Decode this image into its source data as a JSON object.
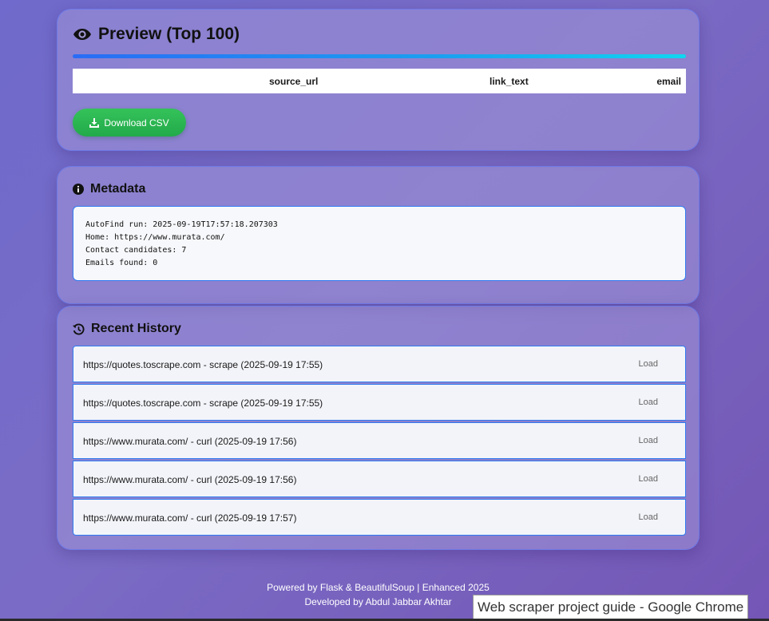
{
  "preview": {
    "title": "Preview (Top 100)",
    "columns": [
      "source_url",
      "link_text",
      "email"
    ],
    "download_label": "Download CSV"
  },
  "metadata": {
    "title": "Metadata",
    "lines": [
      "AutoFind run: 2025-09-19T17:57:18.207303",
      "Home: https://www.murata.com/",
      "Contact candidates: 7",
      "Emails found: 0"
    ]
  },
  "history": {
    "title": "Recent History",
    "items": [
      {
        "text": "https://quotes.toscrape.com - scrape (2025-09-19 17:55)",
        "action": "Load"
      },
      {
        "text": "https://quotes.toscrape.com - scrape (2025-09-19 17:55)",
        "action": "Load"
      },
      {
        "text": "https://www.murata.com/ - curl (2025-09-19 17:56)",
        "action": "Load"
      },
      {
        "text": "https://www.murata.com/ - curl (2025-09-19 17:56)",
        "action": "Load"
      },
      {
        "text": "https://www.murata.com/ - curl (2025-09-19 17:57)",
        "action": "Load"
      }
    ]
  },
  "footer": {
    "line1": "Powered by Flask & BeautifulSoup | Enhanced 2025",
    "line2": "Developed by Abdul Jabbar Akhtar"
  },
  "tooltip": "Web scraper project guide - Google Chrome",
  "icons": {
    "preview": "eye-icon",
    "metadata": "info-circle-icon",
    "history": "history-icon",
    "download": "download-icon"
  }
}
